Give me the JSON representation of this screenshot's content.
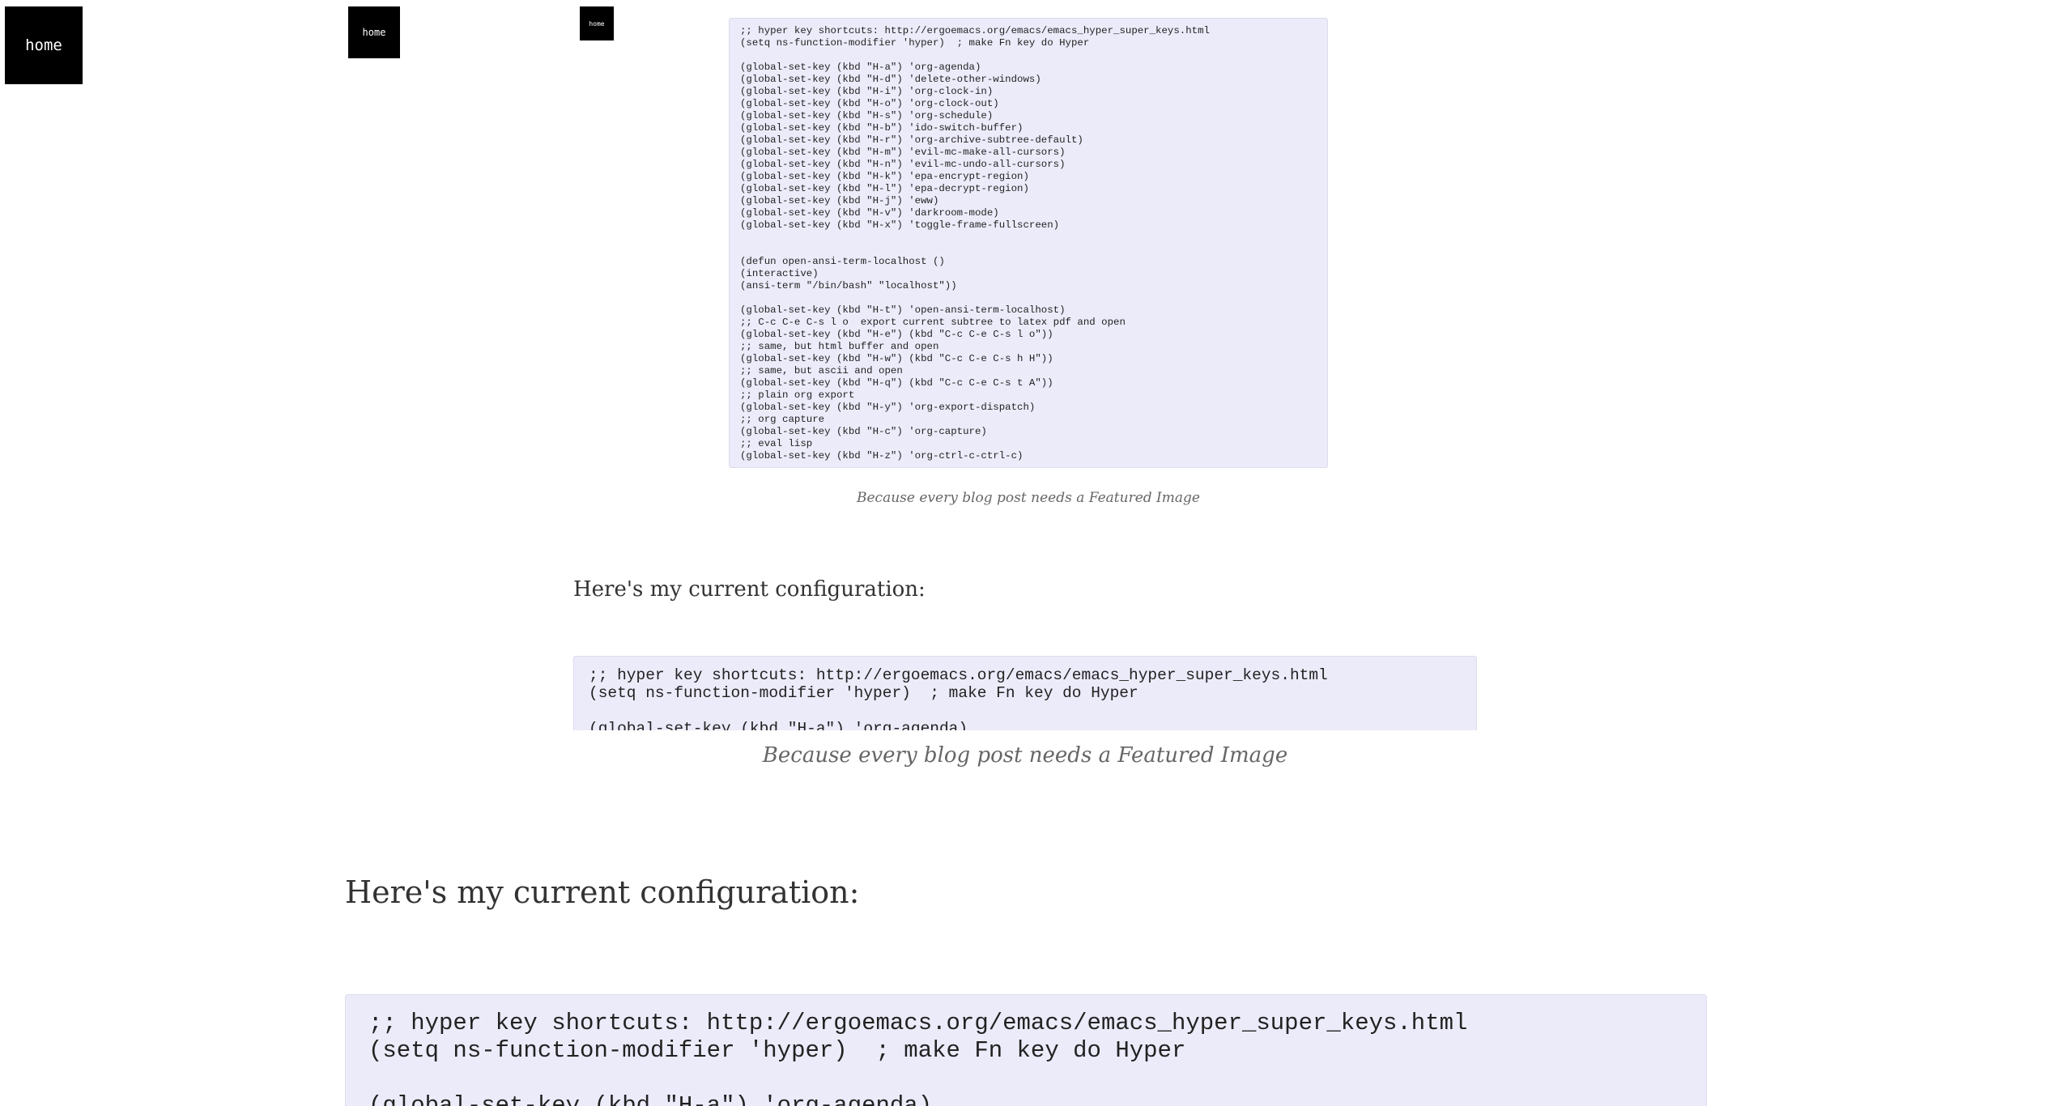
{
  "nav": {
    "home_label": "home"
  },
  "code": {
    "lines_full": ";; hyper key shortcuts: http://ergoemacs.org/emacs/emacs_hyper_super_keys.html\n(setq ns-function-modifier 'hyper)  ; make Fn key do Hyper\n\n(global-set-key (kbd \"H-a\") 'org-agenda)\n(global-set-key (kbd \"H-d\") 'delete-other-windows)\n(global-set-key (kbd \"H-i\") 'org-clock-in)\n(global-set-key (kbd \"H-o\") 'org-clock-out)\n(global-set-key (kbd \"H-s\") 'org-schedule)\n(global-set-key (kbd \"H-b\") 'ido-switch-buffer)\n(global-set-key (kbd \"H-r\") 'org-archive-subtree-default)\n(global-set-key (kbd \"H-m\") 'evil-mc-make-all-cursors)\n(global-set-key (kbd \"H-n\") 'evil-mc-undo-all-cursors)\n(global-set-key (kbd \"H-k\") 'epa-encrypt-region)\n(global-set-key (kbd \"H-l\") 'epa-decrypt-region)\n(global-set-key (kbd \"H-j\") 'eww)\n(global-set-key (kbd \"H-v\") 'darkroom-mode)\n(global-set-key (kbd \"H-x\") 'toggle-frame-fullscreen)\n\n\n(defun open-ansi-term-localhost ()\n(interactive)\n(ansi-term \"/bin/bash\" \"localhost\"))\n\n(global-set-key (kbd \"H-t\") 'open-ansi-term-localhost)\n;; C-c C-e C-s l o  export current subtree to latex pdf and open\n(global-set-key (kbd \"H-e\") (kbd \"C-c C-e C-s l o\"))\n;; same, but html buffer and open\n(global-set-key (kbd \"H-w\") (kbd \"C-c C-e C-s h H\"))\n;; same, but ascii and open\n(global-set-key (kbd \"H-q\") (kbd \"C-c C-e C-s t A\"))\n;; plain org export\n(global-set-key (kbd \"H-y\") 'org-export-dispatch)\n;; org capture\n(global-set-key (kbd \"H-c\") 'org-capture)\n;; eval lisp\n(global-set-key (kbd \"H-z\") 'org-ctrl-c-ctrl-c)",
    "lines_preview": ";; hyper key shortcuts: http://ergoemacs.org/emacs/emacs_hyper_super_keys.html\n(setq ns-function-modifier 'hyper)  ; make Fn key do Hyper\n\n(global-set-key (kbd \"H-a\") 'org-agenda)"
  },
  "article": {
    "caption": "Because every blog post needs a Featured Image",
    "intro": "Here's my current configuration:"
  }
}
